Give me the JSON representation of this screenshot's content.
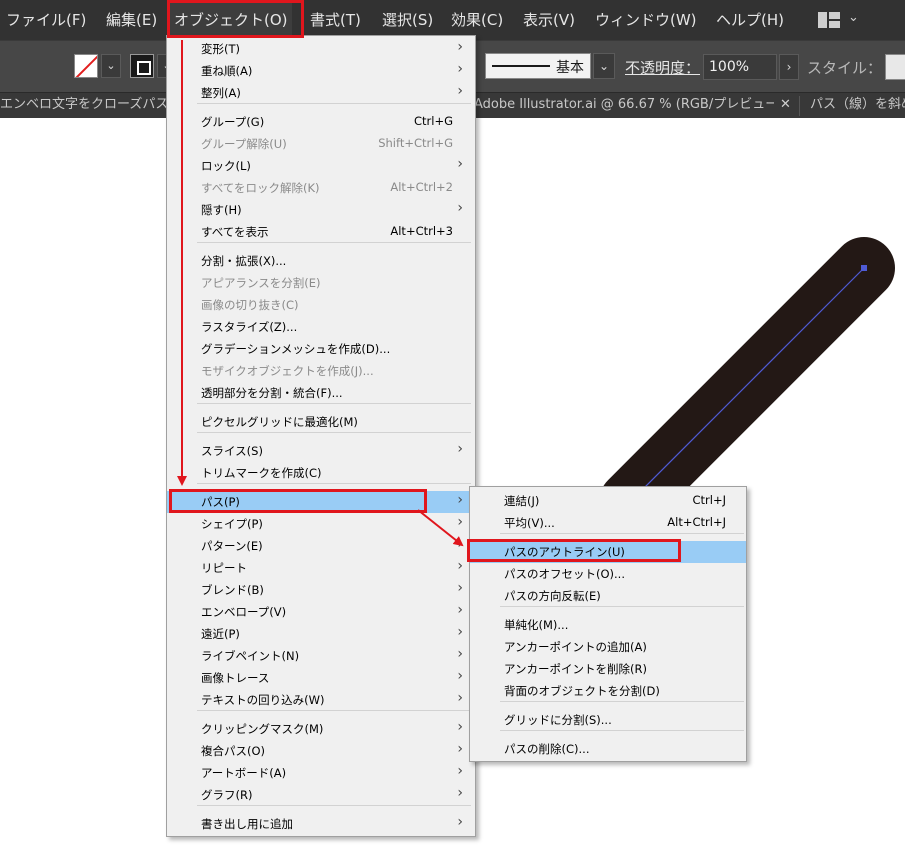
{
  "menubar": {
    "items": [
      "ファイル(F)",
      "編集(E)",
      "オブジェクト(O)",
      "書式(T)",
      "選択(S)",
      "効果(C)",
      "表示(V)",
      "ウィンドウ(W)",
      "ヘルプ(H)"
    ],
    "workspace_icon": "workspace-layout-icon"
  },
  "control": {
    "stroke_profile_label": "基本",
    "opacity_label": "不透明度：",
    "opacity_value": "100%",
    "style_label": "スタイル：",
    "fill_swatch": "none-fill-swatch",
    "colors": {
      "none_slash": "#e21e1e"
    }
  },
  "tabs": [
    {
      "title": "エンベロ文字をクローズパスに"
    },
    {
      "title": "Adobe Illustrator.ai @ 66.67 % (RGB/プレビュー..."
    },
    {
      "title": "パス（線）を斜め"
    }
  ],
  "object_menu": {
    "items": [
      {
        "label": "変形(T)",
        "shortcut": "",
        "submenu": true,
        "disabled": false
      },
      {
        "label": "重ね順(A)",
        "shortcut": "",
        "submenu": true,
        "disabled": false
      },
      {
        "label": "整列(A)",
        "shortcut": "",
        "submenu": true,
        "disabled": false
      },
      {
        "label": "グループ(G)",
        "shortcut": "Ctrl+G",
        "submenu": false,
        "disabled": false
      },
      {
        "label": "グループ解除(U)",
        "shortcut": "Shift+Ctrl+G",
        "submenu": false,
        "disabled": true
      },
      {
        "label": "ロック(L)",
        "shortcut": "",
        "submenu": true,
        "disabled": false
      },
      {
        "label": "すべてをロック解除(K)",
        "shortcut": "Alt+Ctrl+2",
        "submenu": false,
        "disabled": true
      },
      {
        "label": "隠す(H)",
        "shortcut": "",
        "submenu": true,
        "disabled": false
      },
      {
        "label": "すべてを表示",
        "shortcut": "Alt+Ctrl+3",
        "submenu": false,
        "disabled": false
      },
      {
        "label": "分割・拡張(X)...",
        "shortcut": "",
        "submenu": false,
        "disabled": false
      },
      {
        "label": "アピアランスを分割(E)",
        "shortcut": "",
        "submenu": false,
        "disabled": true
      },
      {
        "label": "画像の切り抜き(C)",
        "shortcut": "",
        "submenu": false,
        "disabled": true
      },
      {
        "label": "ラスタライズ(Z)...",
        "shortcut": "",
        "submenu": false,
        "disabled": false
      },
      {
        "label": "グラデーションメッシュを作成(D)...",
        "shortcut": "",
        "submenu": false,
        "disabled": false
      },
      {
        "label": "モザイクオブジェクトを作成(J)...",
        "shortcut": "",
        "submenu": false,
        "disabled": true
      },
      {
        "label": "透明部分を分割・統合(F)...",
        "shortcut": "",
        "submenu": false,
        "disabled": false
      },
      {
        "label": "ピクセルグリッドに最適化(M)",
        "shortcut": "",
        "submenu": false,
        "disabled": false
      },
      {
        "label": "スライス(S)",
        "shortcut": "",
        "submenu": true,
        "disabled": false
      },
      {
        "label": "トリムマークを作成(C)",
        "shortcut": "",
        "submenu": false,
        "disabled": false
      },
      {
        "label": "パス(P)",
        "shortcut": "",
        "submenu": true,
        "disabled": false,
        "highlighted": true
      },
      {
        "label": "シェイプ(P)",
        "shortcut": "",
        "submenu": true,
        "disabled": false
      },
      {
        "label": "パターン(E)",
        "shortcut": "",
        "submenu": true,
        "disabled": false
      },
      {
        "label": "リピート",
        "shortcut": "",
        "submenu": true,
        "disabled": false
      },
      {
        "label": "ブレンド(B)",
        "shortcut": "",
        "submenu": true,
        "disabled": false
      },
      {
        "label": "エンベロープ(V)",
        "shortcut": "",
        "submenu": true,
        "disabled": false
      },
      {
        "label": "遠近(P)",
        "shortcut": "",
        "submenu": true,
        "disabled": false
      },
      {
        "label": "ライブペイント(N)",
        "shortcut": "",
        "submenu": true,
        "disabled": false
      },
      {
        "label": "画像トレース",
        "shortcut": "",
        "submenu": true,
        "disabled": false
      },
      {
        "label": "テキストの回り込み(W)",
        "shortcut": "",
        "submenu": true,
        "disabled": false
      },
      {
        "label": "クリッピングマスク(M)",
        "shortcut": "",
        "submenu": true,
        "disabled": false
      },
      {
        "label": "複合パス(O)",
        "shortcut": "",
        "submenu": true,
        "disabled": false
      },
      {
        "label": "アートボード(A)",
        "shortcut": "",
        "submenu": true,
        "disabled": false
      },
      {
        "label": "グラフ(R)",
        "shortcut": "",
        "submenu": true,
        "disabled": false
      },
      {
        "label": "書き出し用に追加",
        "shortcut": "",
        "submenu": true,
        "disabled": false
      }
    ]
  },
  "path_submenu": {
    "items": [
      {
        "label": "連結(J)",
        "shortcut": "Ctrl+J"
      },
      {
        "label": "平均(V)...",
        "shortcut": "Alt+Ctrl+J"
      },
      {
        "label": "パスのアウトライン(U)",
        "shortcut": "",
        "highlighted": true
      },
      {
        "label": "パスのオフセット(O)...",
        "shortcut": ""
      },
      {
        "label": "パスの方向反転(E)",
        "shortcut": ""
      },
      {
        "label": "単純化(M)...",
        "shortcut": ""
      },
      {
        "label": "アンカーポイントの追加(A)",
        "shortcut": ""
      },
      {
        "label": "アンカーポイントを削除(R)",
        "shortcut": ""
      },
      {
        "label": "背面のオブジェクトを分割(D)",
        "shortcut": ""
      },
      {
        "label": "グリッドに分割(S)...",
        "shortcut": ""
      },
      {
        "label": "パスの削除(C)...",
        "shortcut": ""
      }
    ]
  },
  "colors": {
    "highlight": "#99ccf5",
    "annotation_red": "#e0161d",
    "stroke_dark": "#231815",
    "selection_blue": "#4f5bd5"
  }
}
